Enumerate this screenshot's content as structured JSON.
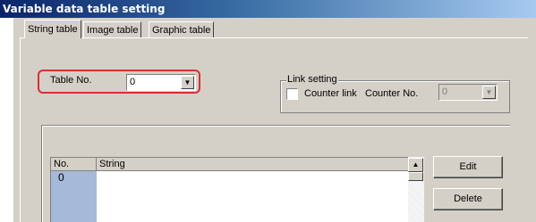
{
  "window": {
    "title": "Variable data table setting"
  },
  "tabs": [
    {
      "label": "String table",
      "active": true
    },
    {
      "label": "Image table",
      "active": false
    },
    {
      "label": "Graphic table",
      "active": false
    }
  ],
  "table_no": {
    "label": "Table No.",
    "value": "0"
  },
  "link_setting": {
    "group_title": "Link setting",
    "counter_link_label": "Counter link",
    "counter_link_checked": false,
    "counter_no_label": "Counter No.",
    "counter_no_value": "0"
  },
  "string_list": {
    "columns": [
      "No.",
      "String"
    ],
    "rows": [
      {
        "no": "0",
        "string": ""
      }
    ]
  },
  "buttons": {
    "edit": "Edit",
    "delete": "Delete"
  },
  "colors": {
    "highlight": "#d93030",
    "selection": "#a6b9d8",
    "dialog_bg": "#d4d0c8"
  }
}
